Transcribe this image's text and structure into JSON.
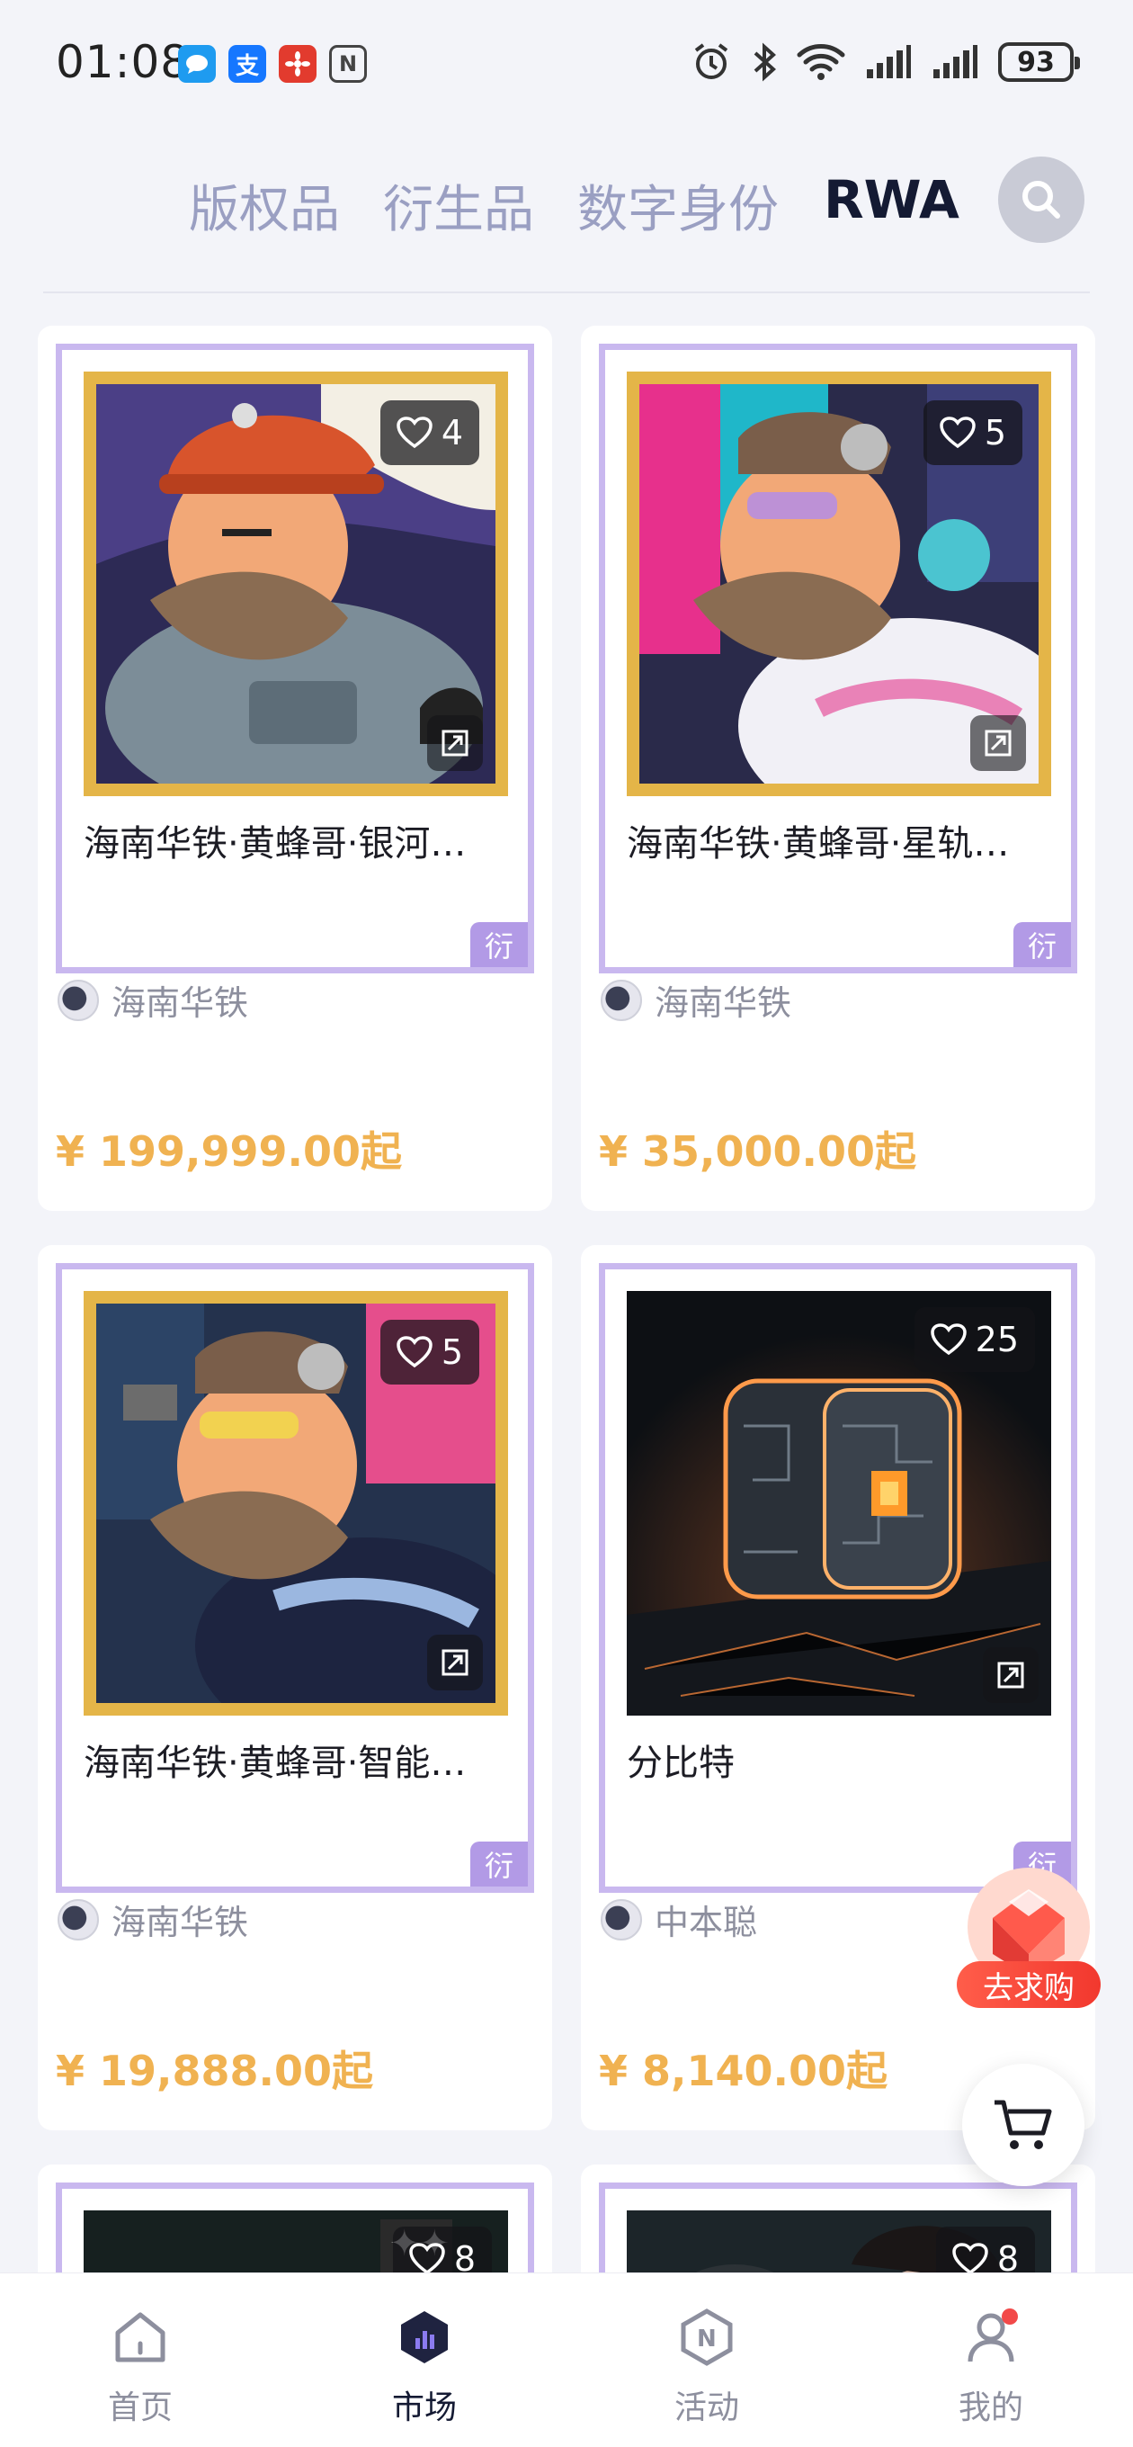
{
  "status_bar": {
    "time": "01:08",
    "battery": "93",
    "app_icons": [
      "message-app-icon",
      "alipay-icon",
      "huawei-app-icon",
      "nfc-icon"
    ],
    "system_icons": [
      "alarm-icon",
      "bluetooth-icon",
      "wifi-icon",
      "signal-icon",
      "signal-icon-2"
    ]
  },
  "tabs": [
    {
      "label": "版权品",
      "active": false
    },
    {
      "label": "衍生品",
      "active": false
    },
    {
      "label": "数字身份",
      "active": false
    },
    {
      "label": "RWA",
      "active": true
    }
  ],
  "products": [
    {
      "title": "海南华铁·黄蜂哥·银河…",
      "likes": "4",
      "tag": "衍",
      "author": "海南华铁",
      "price": "¥ 199,999.00起",
      "art": "hornet-miner"
    },
    {
      "title": "海南华铁·黄蜂哥·星轨…",
      "likes": "5",
      "tag": "衍",
      "author": "海南华铁",
      "price": "¥ 35,000.00起",
      "art": "hornet-astronaut"
    },
    {
      "title": "海南华铁·黄蜂哥·智能…",
      "likes": "5",
      "tag": "衍",
      "author": "海南华铁",
      "price": "¥ 19,888.00起",
      "art": "hornet-tech"
    },
    {
      "title": "分比特",
      "likes": "25",
      "tag": "衍",
      "author": "中本聪",
      "price": "¥ 8,140.00起",
      "art": "glowing-cube"
    },
    {
      "title": "",
      "likes": "8",
      "tag": "",
      "author": "",
      "price": "",
      "art": "drama-poster"
    },
    {
      "title": "",
      "likes": "8",
      "tag": "",
      "author": "",
      "price": "",
      "art": "drama-poster-2"
    }
  ],
  "floating": {
    "buy_label": "去求购",
    "cart_icon": "cart-icon"
  },
  "bottom_nav": [
    {
      "label": "首页",
      "icon": "home-icon",
      "active": false
    },
    {
      "label": "市场",
      "icon": "market-icon",
      "active": true
    },
    {
      "label": "活动",
      "icon": "activity-icon",
      "active": false
    },
    {
      "label": "我的",
      "icon": "profile-icon",
      "active": false
    }
  ],
  "colors": {
    "accent": "#f0b251",
    "frame": "#c9b8ef",
    "tag": "#b29ae6",
    "active_tab": "#141a33",
    "inactive_tab": "#9a9fc2",
    "notification": "#f24949"
  }
}
